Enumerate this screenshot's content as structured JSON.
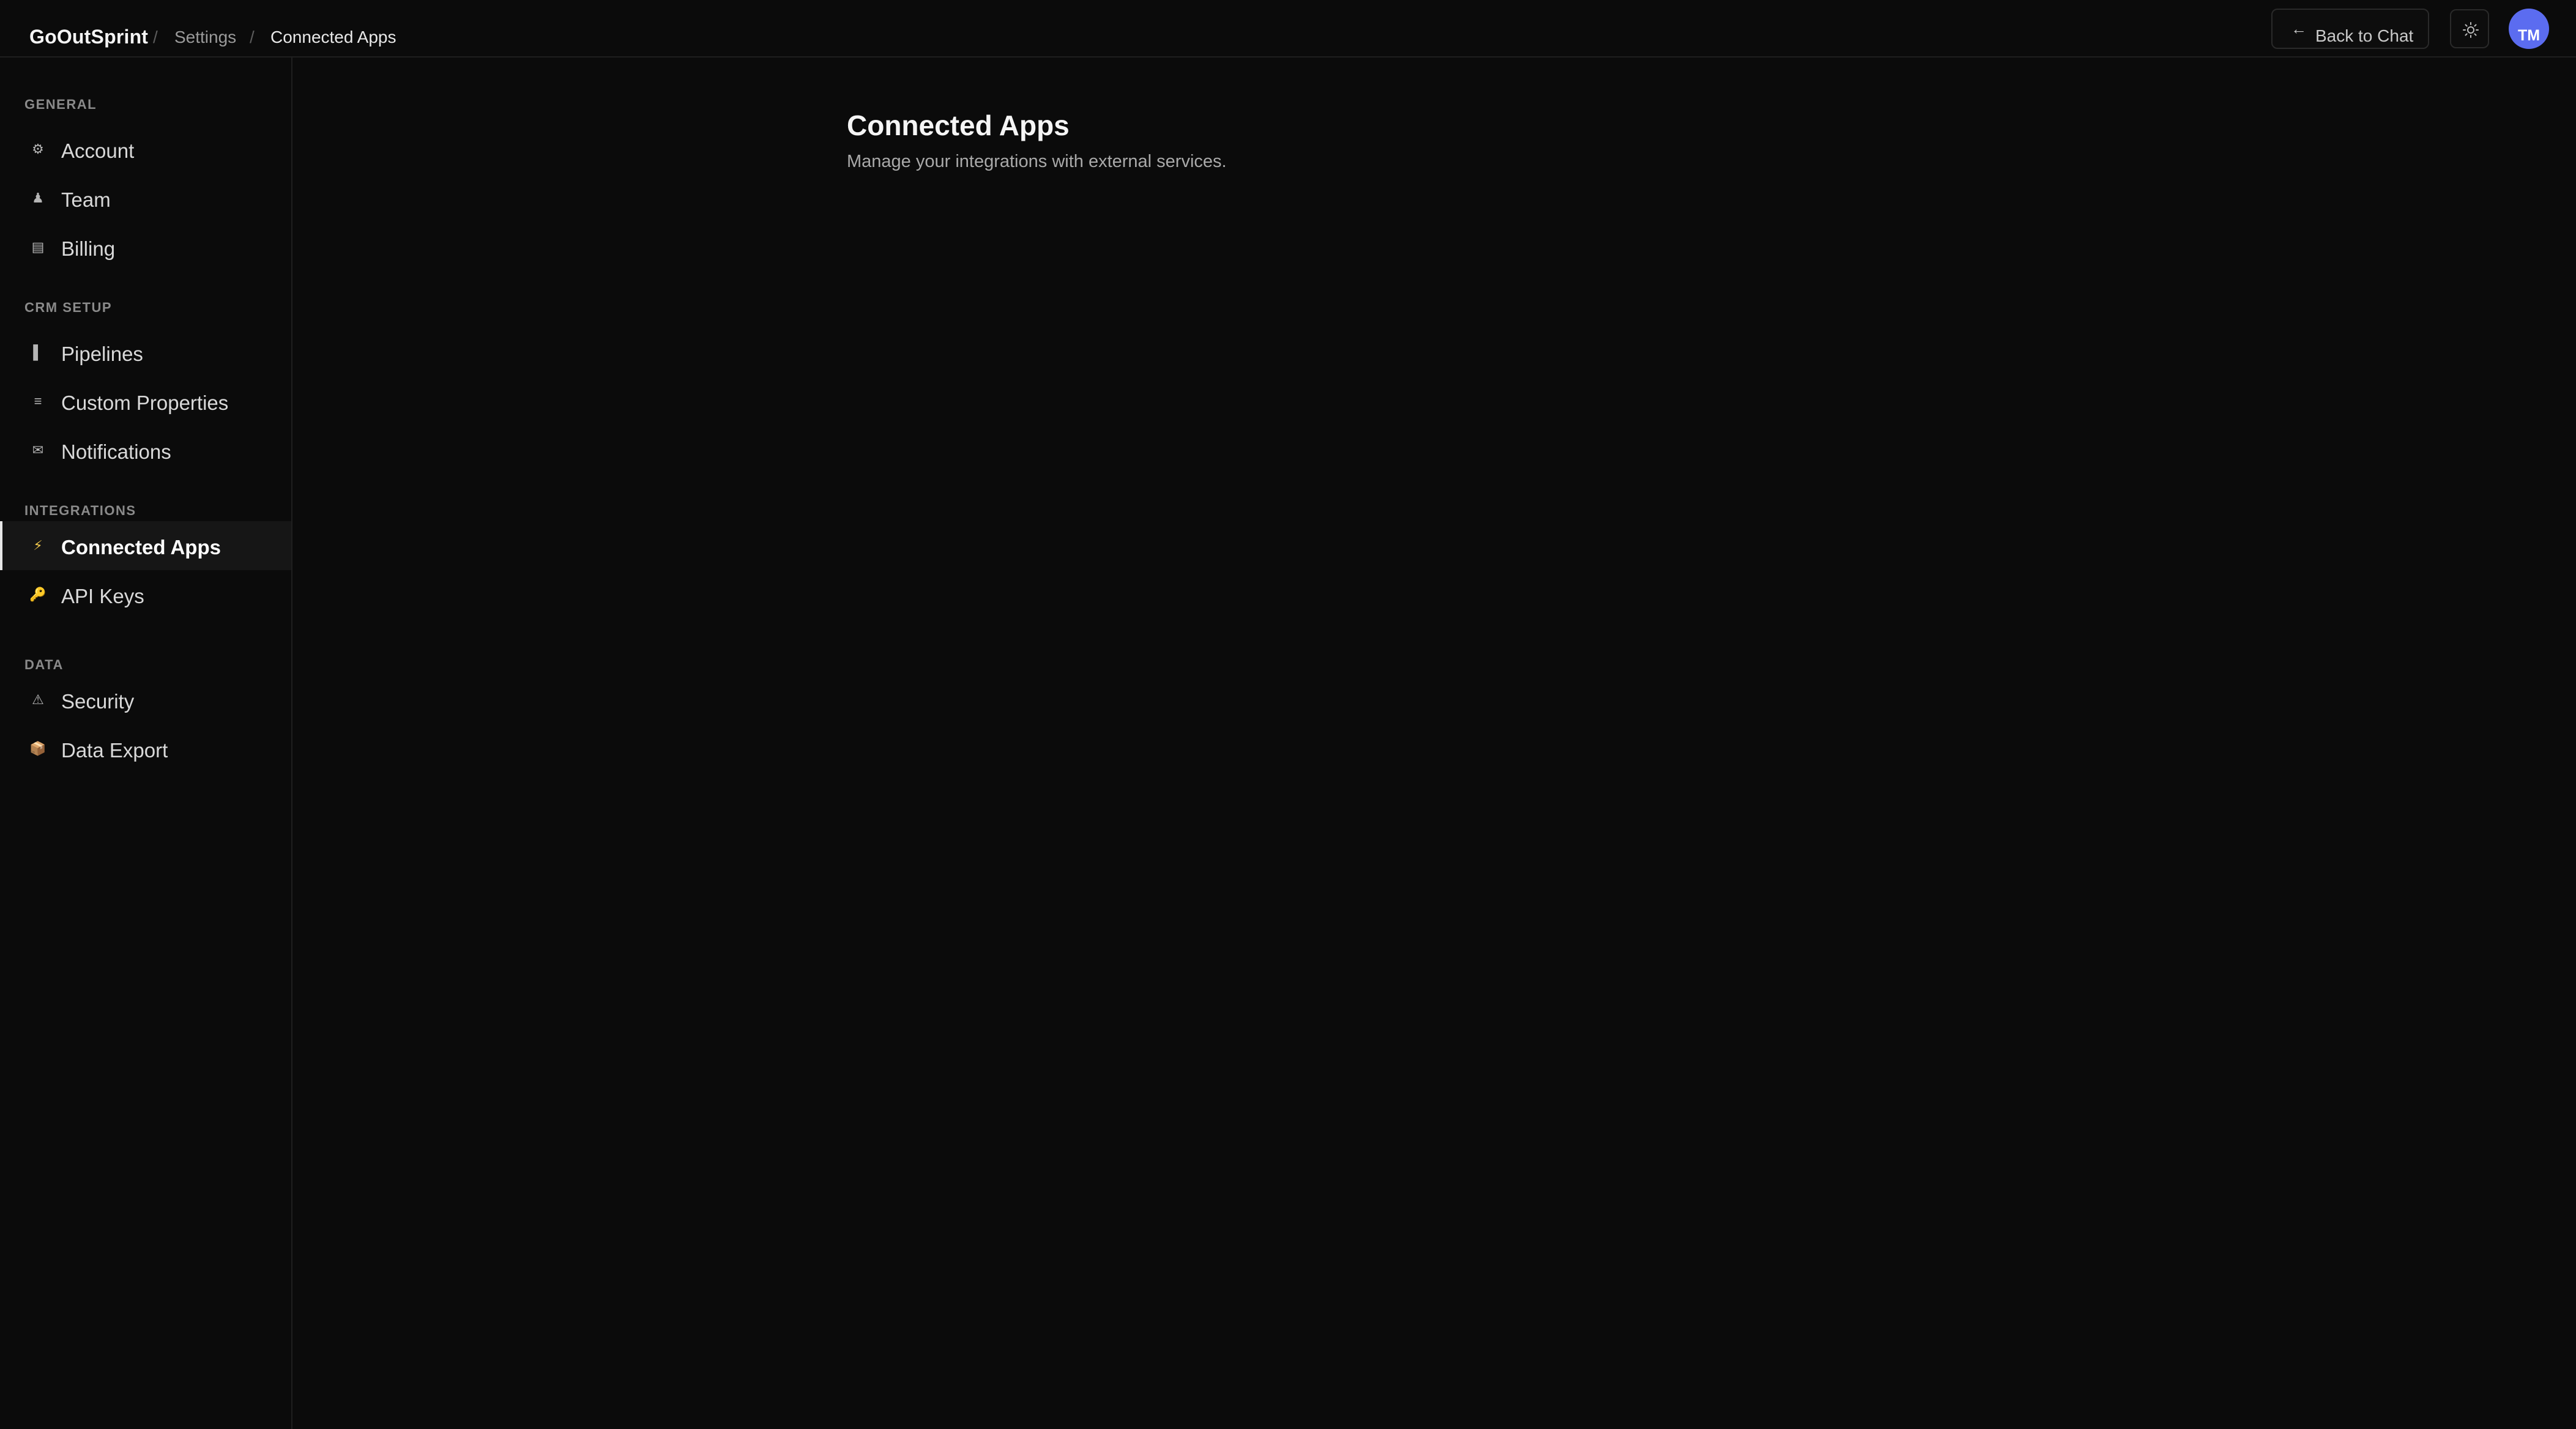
{
  "header": {
    "brand": "GoOutSprint",
    "separator": "/",
    "breadcrumb": [
      "Settings",
      "Connected Apps"
    ],
    "back_label": "Back to Chat",
    "avatar_initials": "TM",
    "avatar_color": "#5b6cf0"
  },
  "sidebar": {
    "sections": [
      {
        "title": "GENERAL",
        "items": [
          {
            "label": "Account",
            "icon": "gear-icon"
          },
          {
            "label": "Team",
            "icon": "user-icon"
          },
          {
            "label": "Billing",
            "icon": "card-icon"
          }
        ]
      },
      {
        "title": "CRM SETUP",
        "items": [
          {
            "label": "Pipelines",
            "icon": "bar-icon"
          },
          {
            "label": "Custom Properties",
            "icon": "list-icon"
          },
          {
            "label": "Notifications",
            "icon": "mail-icon"
          }
        ]
      },
      {
        "title": "INTEGRATIONS",
        "items": [
          {
            "label": "Connected Apps",
            "icon": "lightning-icon",
            "active": true
          },
          {
            "label": "API Keys",
            "icon": "key-icon"
          }
        ]
      },
      {
        "title": "DATA",
        "items": [
          {
            "label": "Security",
            "icon": "warning-icon"
          },
          {
            "label": "Data Export",
            "icon": "package-icon"
          }
        ]
      }
    ]
  },
  "main": {
    "title": "Connected Apps",
    "subtitle": "Manage your integrations with external services."
  }
}
